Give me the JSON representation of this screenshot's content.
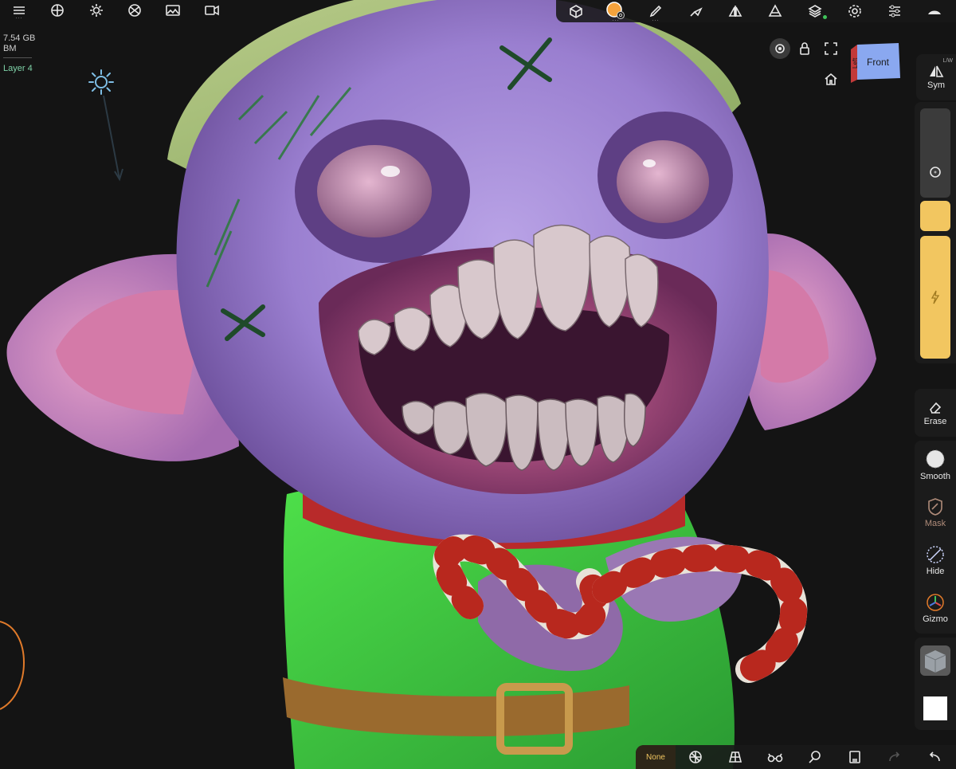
{
  "memory": {
    "line1": "7.54 GB",
    "line2": "BM"
  },
  "layer": {
    "label": "Layer 4"
  },
  "toolbar_left": {
    "icons": [
      "menu-icon",
      "sphere-icon",
      "sun-icon",
      "material-ball-icon",
      "image-icon",
      "camera-icon"
    ],
    "dots": "..."
  },
  "toolbar_right": {
    "icons": [
      "scene-icon",
      "material-swatch-icon",
      "brush-icon",
      "paint-icon",
      "symmetry-icon",
      "topology-icon",
      "layers-icon",
      "settings-icon",
      "sliders-icon",
      "shading-icon"
    ],
    "dots": "...",
    "swatch_color": "#f5a23c",
    "layers_dot_color": "#3fc45a"
  },
  "view_controls": {
    "home_icon": "home-icon",
    "lock_icon": "lock-icon",
    "expand_icon": "expand-icon",
    "eye_icon": "eye-icon",
    "cube_front": "Front",
    "cube_left": "Left"
  },
  "right_panel": {
    "sym_label": "Sym",
    "sym_superscript": "L/W",
    "accent_color": "#f2c660",
    "tools": [
      {
        "name": "Erase"
      },
      {
        "name": "Smooth"
      },
      {
        "name": "Mask"
      },
      {
        "name": "Hide"
      },
      {
        "name": "Gizmo"
      }
    ]
  },
  "bottom_bar": {
    "none_label": "None",
    "icons": [
      "wireframe-icon",
      "perspective-icon",
      "glasses-icon",
      "search-icon",
      "document-icon",
      "redo-icon",
      "undo-icon"
    ]
  },
  "colors": {
    "accent_yellow": "#f2c660",
    "layer_green": "#7fd3a8",
    "sun_blue": "#7fbfe6",
    "orange_ring": "#e07a2a"
  }
}
